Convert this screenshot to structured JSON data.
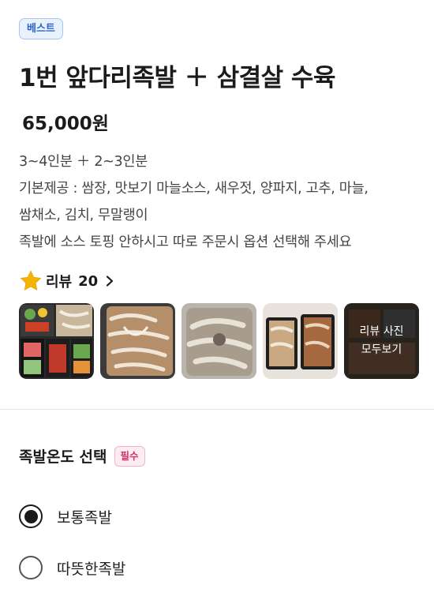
{
  "product": {
    "badge": "베스트",
    "title": "1번 앞다리족발 ＋ 삼결살 수육",
    "price": "65,000원",
    "description_lines": [
      "3~4인분 ＋ 2~3인분",
      "기본제공 : 쌈장, 맛보기 마늘소스, 새우젓, 양파지, 고추, 마늘,",
      "쌈채소, 김치, 무말랭이",
      "족발에 소스 토핑 안하시고 따로 주문시 옵션 선택해 주세요"
    ]
  },
  "reviews": {
    "label": "리뷰",
    "count": "20",
    "star_icon": "star-icon",
    "star_color": "#f5b400",
    "view_all_line1": "리뷰 사진",
    "view_all_line2": "모두보기"
  },
  "options": {
    "title": "족발온도 선택",
    "required_badge": "필수",
    "items": [
      {
        "label": "보통족발",
        "selected": true
      },
      {
        "label": "따뜻한족발",
        "selected": false
      }
    ]
  },
  "colors": {
    "best_badge": "#2b67c8",
    "required_badge": "#d62f6c"
  }
}
